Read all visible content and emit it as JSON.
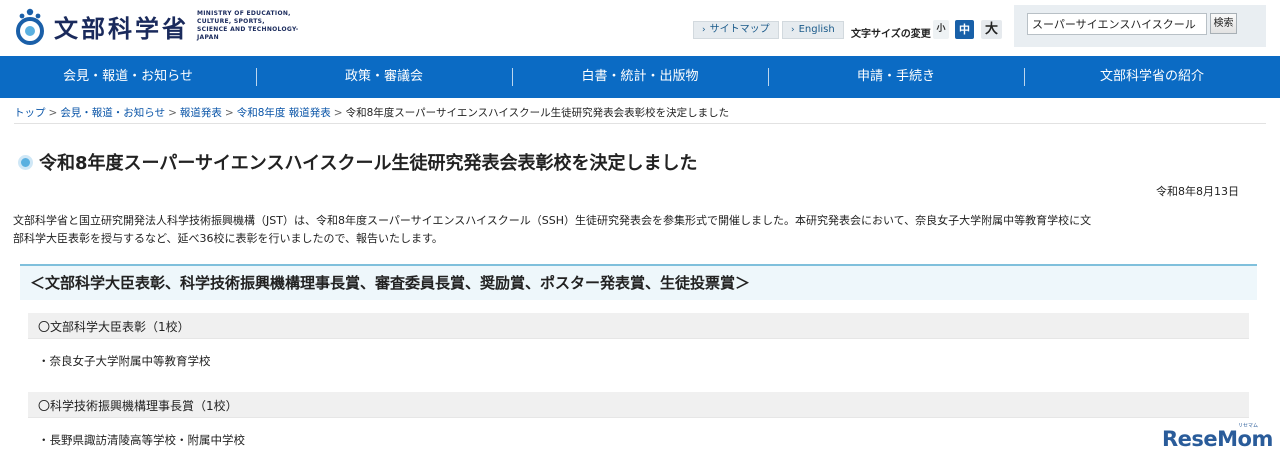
{
  "header": {
    "logo_jp": "文部科学省",
    "logo_en_line1": "MINISTRY OF EDUCATION,",
    "logo_en_line2": "CULTURE, SPORTS,",
    "logo_en_line3": "SCIENCE AND TECHNOLOGY-JAPAN",
    "sitemap": "サイトマップ",
    "english": "English",
    "font_size_label": "文字サイズの変更",
    "font_small": "小",
    "font_mid": "中",
    "font_large": "大",
    "search_value": "スーパーサイエンスハイスクール",
    "search_button": "検索"
  },
  "nav": {
    "items": [
      "会見・報道・お知らせ",
      "政策・審議会",
      "白書・統計・出版物",
      "申請・手続き",
      "文部科学省の紹介"
    ]
  },
  "breadcrumb": {
    "items": [
      "トップ",
      "会見・報道・お知らせ",
      "報道発表",
      "令和8年度 報道発表"
    ],
    "current": "令和8年度スーパーサイエンスハイスクール生徒研究発表会表彰校を決定しました"
  },
  "main": {
    "title": "令和8年度スーパーサイエンスハイスクール生徒研究発表会表彰校を決定しました",
    "date": "令和8年8月13日",
    "intro_line1": "文部科学省と国立研究開発法人科学技術振興機構（JST）は、令和8年度スーパーサイエンスハイスクール（SSH）生徒研究発表会を参集形式で開催しました。本研究発表会において、奈良女子大学附属中等教育学校に文",
    "intro_line2": "部科学大臣表彰を授与するなど、延べ36校に表彰を行いましたので、報告いたします。",
    "section_title": "＜文部科学大臣表彰、科学技術振興機構理事長賞、審査委員長賞、奨励賞、ポスター発表賞、生徒投票賞＞",
    "awards": [
      {
        "heading": "〇文部科学大臣表彰（1校）",
        "item": "・奈良女子大学附属中等教育学校"
      },
      {
        "heading": "〇科学技術振興機構理事長賞（1校）",
        "item": "・長野県諏訪清陵高等学校・附属中学校"
      }
    ]
  },
  "watermark": {
    "text": "ReseMom",
    "sub": "リセマム"
  },
  "colors": {
    "nav_bg": "#0b6bc4",
    "link": "#0a55a8",
    "section_bg": "#eef7fb",
    "section_border": "#7fc0dc",
    "font_mid_active": "#1860a8"
  }
}
